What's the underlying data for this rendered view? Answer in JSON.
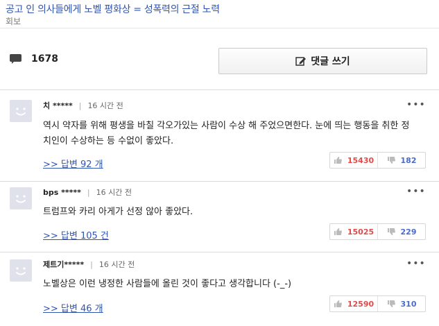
{
  "header": {
    "ad_title": "공고 인 의사들에게 노벨 평화상 = 성폭력의 근절 노력",
    "subtitle": "회보"
  },
  "summary": {
    "comment_count": "1678",
    "write_button_label": "댓글 쓰기"
  },
  "comments": [
    {
      "nickname": "치 *****",
      "time": "16 시간 전",
      "more": "•••",
      "body": "역시 약자를 위해 평생을 바칠 각오가있는 사람이 수상 해 주었으면한다. 눈에 띄는 행동을 취한 정치인이 수상하는 등 수없이 좋았다.",
      "reply_link": ">> 답변  92 개",
      "likes": "15430",
      "dislikes": "182"
    },
    {
      "nickname": "bps *****",
      "time": "16 시간 전",
      "more": "•••",
      "body": "트럼프와 카리 아게가 선정 않아 좋았다.",
      "reply_link": ">> 답변  105 건",
      "likes": "15025",
      "dislikes": "229"
    },
    {
      "nickname": "제트기*****",
      "time": "16 시간 전",
      "more": "•••",
      "body": "노벨상은 이런 냉정한 사람들에 올린 것이 좋다고 생각합니다 (-_-)",
      "reply_link": ">> 답변  46 개",
      "likes": "12590",
      "dislikes": "310"
    }
  ],
  "colors": {
    "link": "#2f54b0",
    "like": "#e24a4a",
    "dislike": "#4a6bc8",
    "avatar_bg": "#dfe2ea"
  },
  "icons": {
    "comment": "speech-bubble-icon",
    "write": "pencil-edit-icon",
    "avatar": "smiley-face-icon",
    "like": "thumbs-up-icon",
    "dislike": "thumbs-down-icon",
    "more": "ellipsis-icon"
  }
}
